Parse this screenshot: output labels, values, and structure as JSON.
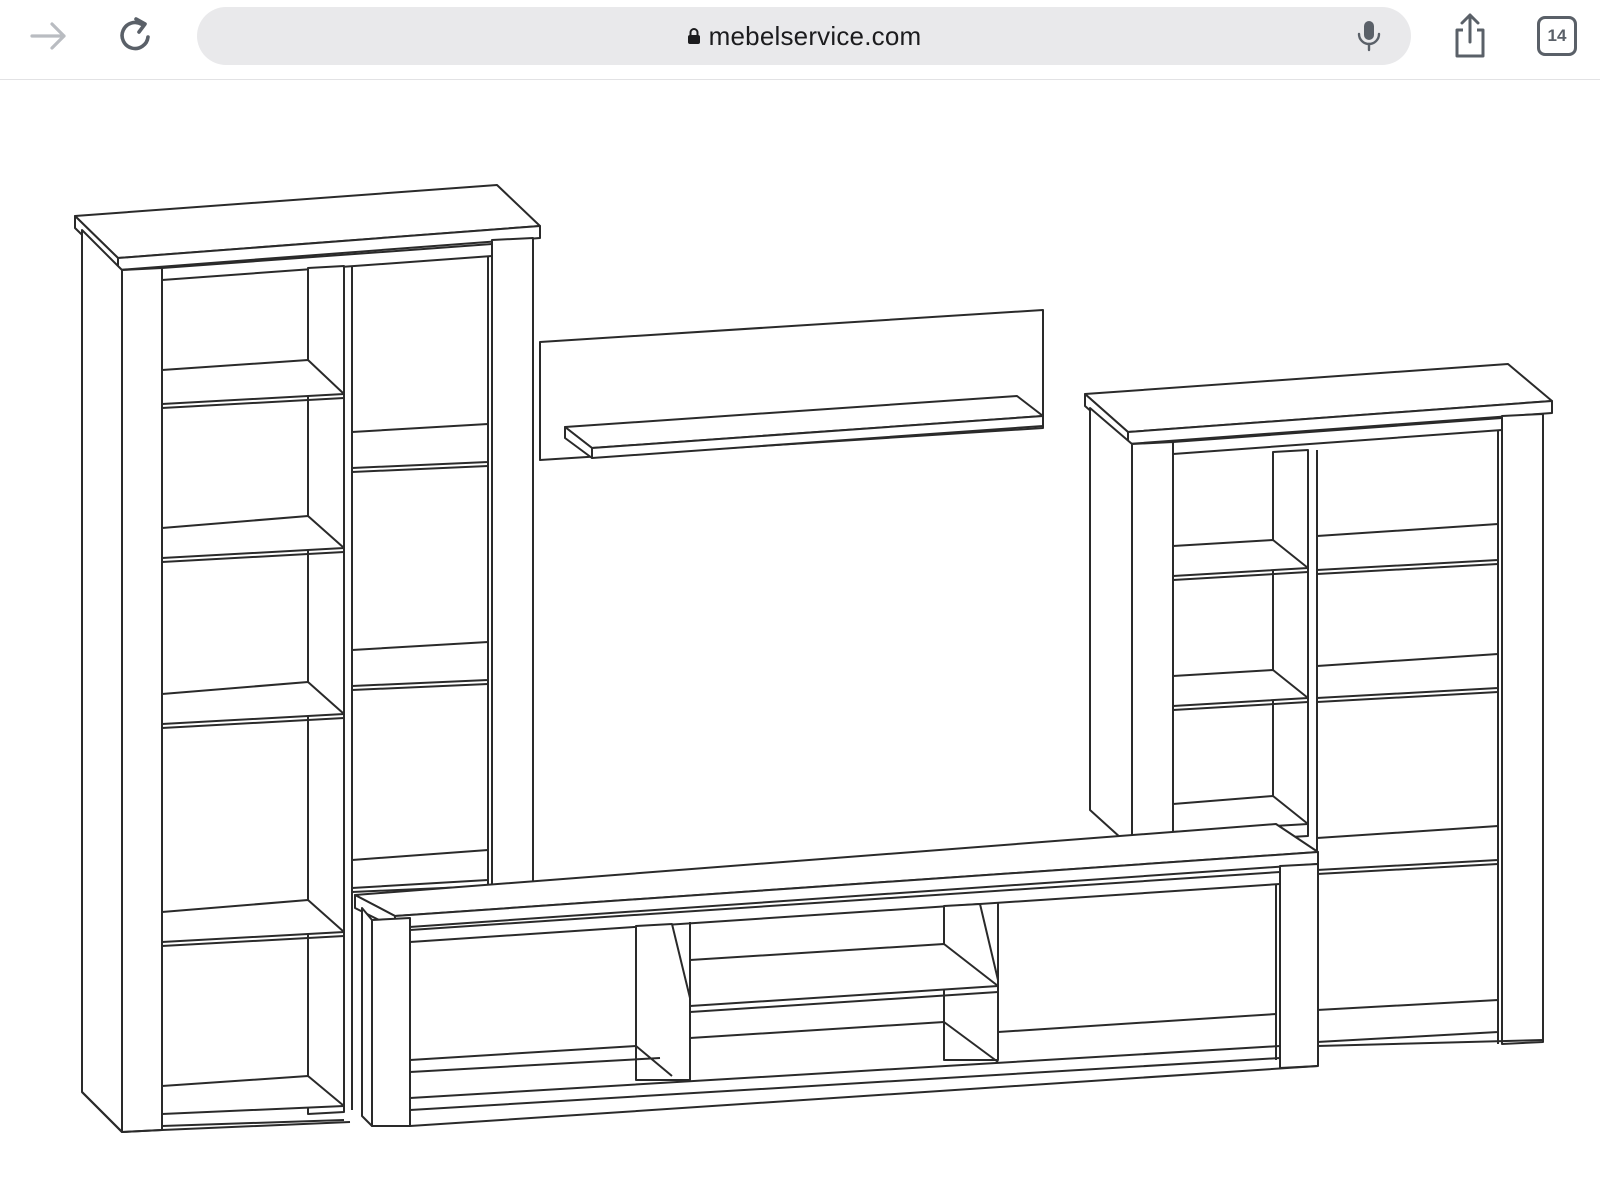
{
  "browser": {
    "url": "mebelservice.com",
    "tab_count": "14",
    "icons": {
      "forward": "arrow-right-icon",
      "reload": "reload-icon",
      "lock": "lock-icon",
      "mic": "microphone-icon",
      "share": "share-icon",
      "tabs": "tabs-icon"
    },
    "colors": {
      "address_bar": "#e9e9eb",
      "icon": "#5a6068",
      "icon_disabled": "#b9bcc1",
      "text": "#1c1c1e"
    }
  }
}
